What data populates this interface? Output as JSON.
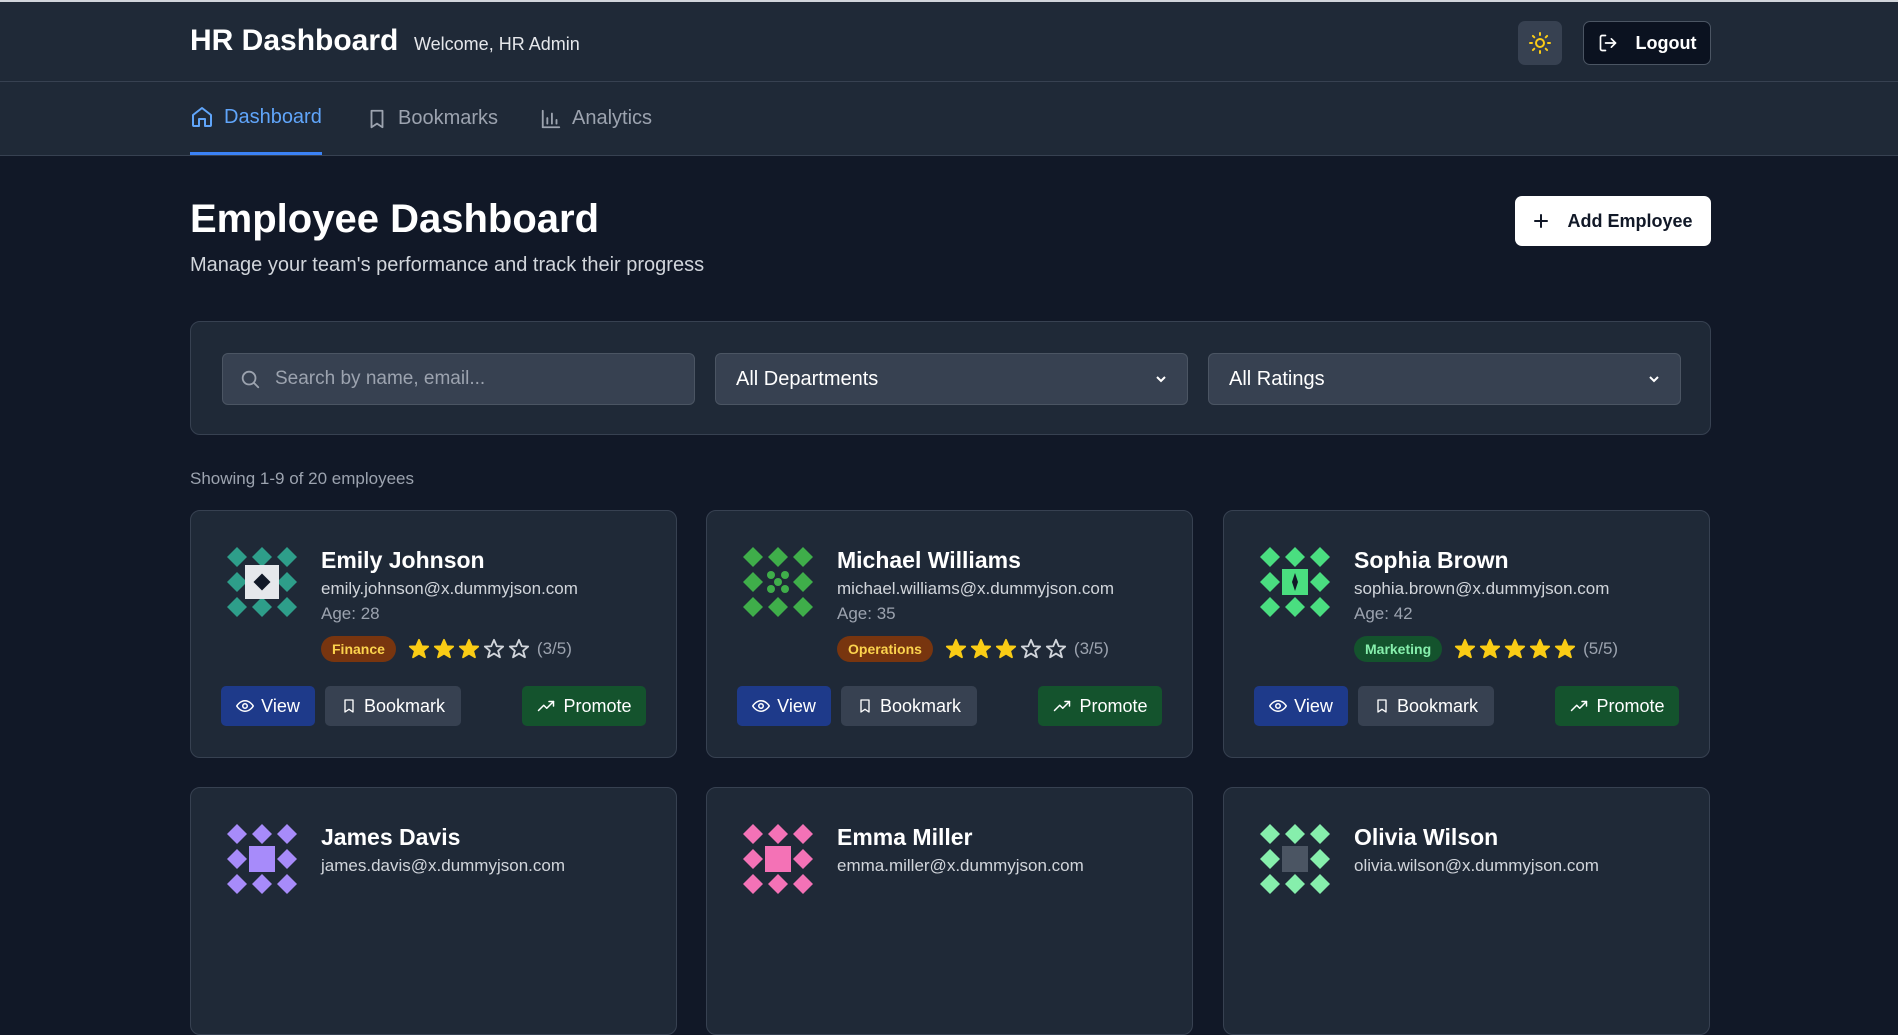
{
  "header": {
    "brand": "HR Dashboard",
    "welcome": "Welcome, HR Admin",
    "theme_icon": "sun-icon",
    "logout_label": "Logout"
  },
  "nav": {
    "items": [
      {
        "label": "Dashboard",
        "icon": "home-icon",
        "active": true
      },
      {
        "label": "Bookmarks",
        "icon": "bookmark-icon",
        "active": false
      },
      {
        "label": "Analytics",
        "icon": "bar-chart-icon",
        "active": false
      }
    ]
  },
  "page": {
    "title": "Employee Dashboard",
    "subtitle": "Manage your team's performance and track their progress",
    "add_label": "Add Employee"
  },
  "filters": {
    "search_placeholder": "Search by name, email...",
    "department": "All Departments",
    "rating": "All Ratings"
  },
  "count_text": "Showing 1-9 of 20 employees",
  "buttons": {
    "view": "View",
    "bookmark": "Bookmark",
    "promote": "Promote"
  },
  "colors": {
    "accent": "#3b82f6",
    "background": "#111827",
    "surface": "#1f2937",
    "star": "#facc15"
  },
  "employees": [
    {
      "name": "Emily Johnson",
      "email": "emily.johnson@x.dummyjson.com",
      "age": "Age: 28",
      "department": "Finance",
      "dept_bg": "#78350f",
      "dept_fg": "#fcd34d",
      "rating": 3,
      "rating_text": "(3/5)",
      "avatar_color": "#2e9e8a"
    },
    {
      "name": "Michael Williams",
      "email": "michael.williams@x.dummyjson.com",
      "age": "Age: 35",
      "department": "Operations",
      "dept_bg": "#78350f",
      "dept_fg": "#fcd34d",
      "rating": 3,
      "rating_text": "(3/5)",
      "avatar_color": "#3fae4a"
    },
    {
      "name": "Sophia Brown",
      "email": "sophia.brown@x.dummyjson.com",
      "age": "Age: 42",
      "department": "Marketing",
      "dept_bg": "#14532d",
      "dept_fg": "#86efac",
      "rating": 5,
      "rating_text": "(5/5)",
      "avatar_color": "#4ade80"
    },
    {
      "name": "James Davis",
      "email": "james.davis@x.dummyjson.com",
      "age": "",
      "department": "",
      "rating": 0,
      "rating_text": "",
      "avatar_color": "#a78bfa"
    },
    {
      "name": "Emma Miller",
      "email": "emma.miller@x.dummyjson.com",
      "age": "",
      "department": "",
      "rating": 0,
      "rating_text": "",
      "avatar_color": "#f472b6"
    },
    {
      "name": "Olivia Wilson",
      "email": "olivia.wilson@x.dummyjson.com",
      "age": "",
      "department": "",
      "rating": 0,
      "rating_text": "",
      "avatar_color": "#86efac"
    }
  ]
}
